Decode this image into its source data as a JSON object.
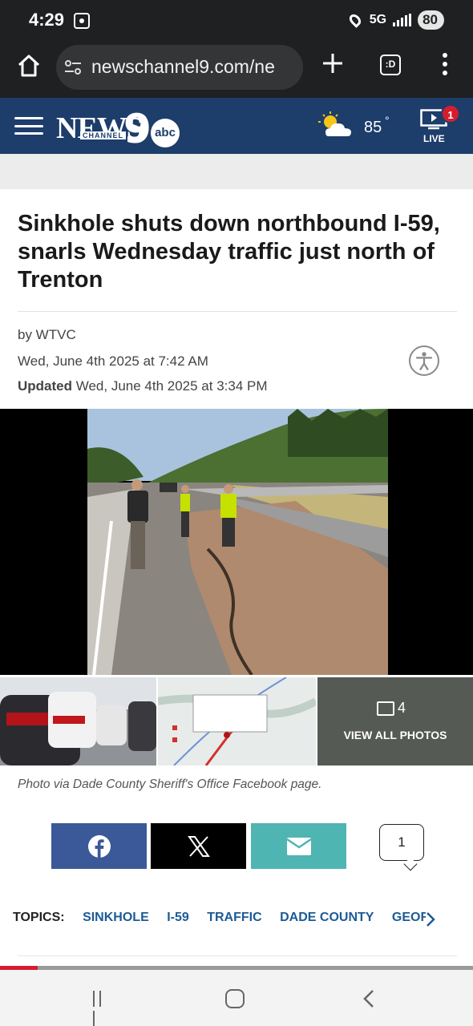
{
  "status_bar": {
    "time": "4:29",
    "network": "5G",
    "battery": "80"
  },
  "browser": {
    "url": "newschannel9.com/ne",
    "tabs_label": ":D"
  },
  "site_header": {
    "logo_news": "NEWS",
    "logo_channel": "CHANNEL",
    "logo_nine": "9",
    "logo_abc": "abc",
    "temperature": "85",
    "degree_symbol": "°",
    "live_label": "LIVE",
    "live_badge": "1"
  },
  "article": {
    "headline": "Sinkhole shuts down northbound I-59, snarls Wednesday traffic just north of Trenton",
    "byline": "by WTVC",
    "published": "Wed, June 4th 2025 at 7:42 AM",
    "updated_label": "Updated",
    "updated": "Wed, June 4th 2025 at 3:34 PM",
    "photo_caption": "Photo via Dade County Sheriff's Office Facebook page."
  },
  "gallery": {
    "count": "4",
    "view_all_label": "VIEW ALL PHOTOS"
  },
  "share": {
    "comment_count": "1"
  },
  "topics": {
    "label": "TOPICS:",
    "items": [
      "SINKHOLE",
      "I-59",
      "TRAFFIC",
      "DADE COUNTY",
      "GEORGIA"
    ]
  },
  "reading_progress": 0.08,
  "colors": {
    "header_blue": "#1d3d6b",
    "facebook": "#3b5998",
    "email": "#4fb5b3",
    "topic_link": "#1d5a96",
    "badge_red": "#d61d2f"
  },
  "icons": [
    "home-icon",
    "tune-icon",
    "plus-icon",
    "tab-switcher-icon",
    "overflow-menu-icon",
    "hamburger-icon",
    "weather-partly-sunny-icon",
    "live-tv-icon",
    "accessibility-icon",
    "gallery-icon",
    "facebook-icon",
    "x-icon",
    "email-icon",
    "comment-icon",
    "chevron-right-icon",
    "recent-apps-icon",
    "home-nav-icon",
    "back-icon"
  ]
}
